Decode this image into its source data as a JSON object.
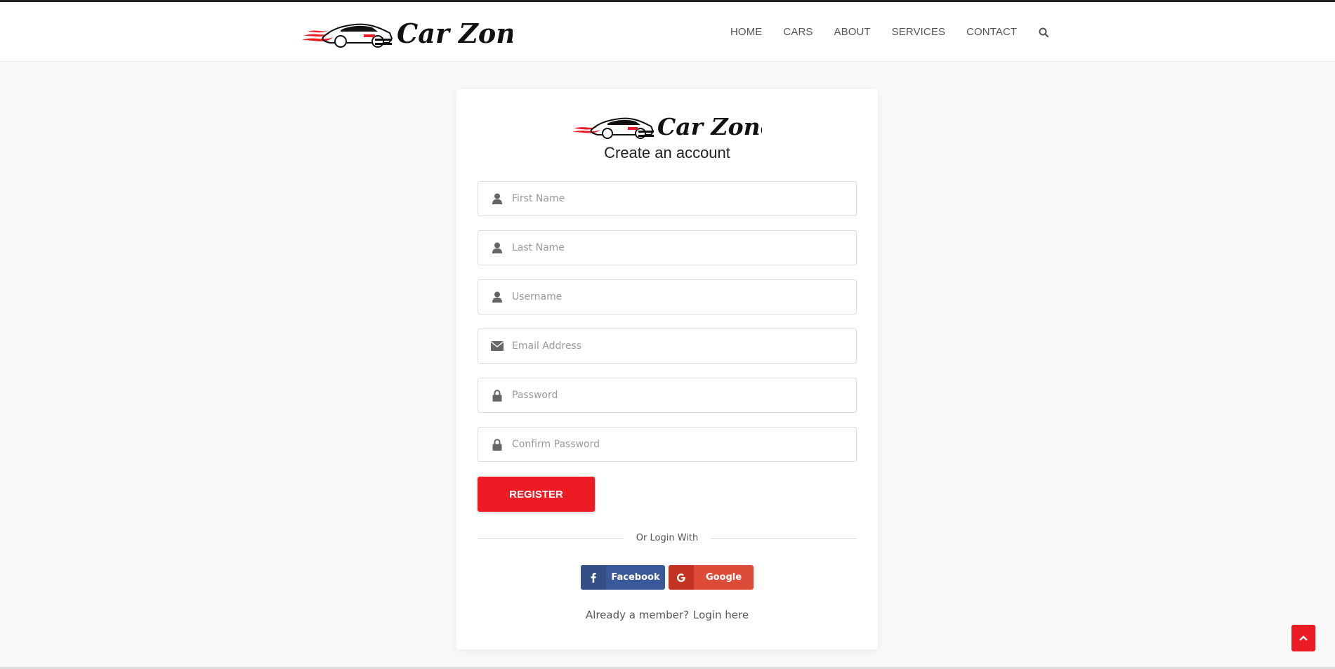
{
  "header": {
    "brand_text": "Car Zone",
    "nav": [
      "HOME",
      "CARS",
      "ABOUT",
      "SERVICES",
      "CONTACT"
    ],
    "search_icon": "search-icon"
  },
  "card": {
    "brand_text": "Car Zone",
    "title": "Create an account",
    "fields": [
      {
        "icon": "user-icon",
        "placeholder": "First Name",
        "value": ""
      },
      {
        "icon": "user-icon",
        "placeholder": "Last Name",
        "value": ""
      },
      {
        "icon": "user-icon",
        "placeholder": "Username",
        "value": ""
      },
      {
        "icon": "envelope-icon",
        "placeholder": "Email Address",
        "value": ""
      },
      {
        "icon": "lock-icon",
        "placeholder": "Password",
        "value": ""
      },
      {
        "icon": "lock-icon",
        "placeholder": "Confirm Password",
        "value": ""
      }
    ],
    "register_label": "REGISTER",
    "divider_text": "Or Login With",
    "social": {
      "facebook_label": "Facebook",
      "google_label": "Google"
    },
    "member_text": "Already a member?",
    "login_link": "Login here"
  },
  "colors": {
    "accent": "#ed1b24",
    "facebook": "#3b5998",
    "google": "#dd4b39"
  }
}
